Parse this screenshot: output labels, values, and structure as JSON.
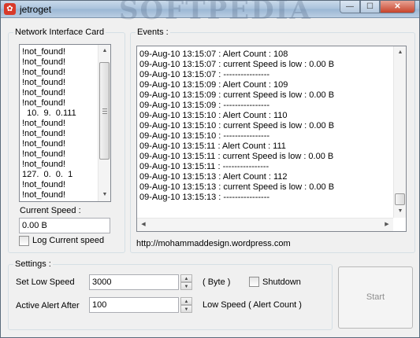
{
  "window": {
    "title": "jetroget",
    "watermark": "SOFTPEDIA",
    "controls": {
      "minimize": "—",
      "maximize": "☐",
      "close": "✕"
    }
  },
  "nic_group": {
    "label": "Network Interface Card",
    "items": [
      "!not_found!",
      "!not_found!",
      "!not_found!",
      "!not_found!",
      "!not_found!",
      "!not_found!",
      "  10.  9.  0.111",
      "!not_found!",
      "!not_found!",
      "!not_found!",
      "!not_found!",
      "!not_found!",
      "127.  0.  0.  1",
      "!not_found!",
      "!not_found!"
    ],
    "current_speed_label": "Current Speed :",
    "current_speed_value": "0.00 B",
    "log_checkbox_label": "Log Current speed"
  },
  "events_group": {
    "label": "Events :",
    "lines": [
      "09-Aug-10 13:15:07 : Alert Count : 108",
      "09-Aug-10 13:15:07 : current Speed is low : 0.00 B",
      "09-Aug-10 13:15:07 : ----------------",
      "09-Aug-10 13:15:09 : Alert Count : 109",
      "09-Aug-10 13:15:09 : current Speed is low : 0.00 B",
      "09-Aug-10 13:15:09 : ----------------",
      "09-Aug-10 13:15:10 : Alert Count : 110",
      "09-Aug-10 13:15:10 : current Speed is low : 0.00 B",
      "09-Aug-10 13:15:10 : ----------------",
      "09-Aug-10 13:15:11 : Alert Count : 111",
      "09-Aug-10 13:15:11 : current Speed is low : 0.00 B",
      "09-Aug-10 13:15:11 : ----------------",
      "09-Aug-10 13:15:13 : Alert Count : 112",
      "09-Aug-10 13:15:13 : current Speed is low : 0.00 B",
      "09-Aug-10 13:15:13 : ----------------"
    ],
    "url": "http://mohammaddesign.wordpress.com"
  },
  "settings_group": {
    "label": "Settings :",
    "low_speed_label": "Set Low Speed",
    "low_speed_value": "3000",
    "low_speed_unit": "( Byte )",
    "shutdown_label": "Shutdown",
    "alert_after_label": "Active Alert After",
    "alert_after_value": "100",
    "alert_after_unit": "Low Speed ( Alert Count )"
  },
  "start_button": {
    "label": "Start"
  },
  "icons": {
    "app": "paw-icon",
    "scroll_up": "▲",
    "scroll_down": "▼",
    "scroll_left": "◀",
    "scroll_right": "▶"
  }
}
